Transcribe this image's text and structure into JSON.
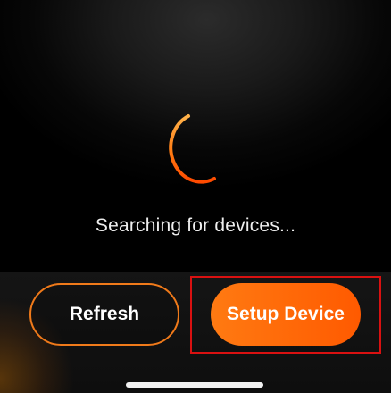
{
  "status": {
    "message": "Searching for devices..."
  },
  "actions": {
    "refresh_label": "Refresh",
    "setup_label": "Setup Device"
  },
  "icons": {
    "spinner": "loading-spinner-icon",
    "home": "home-indicator"
  },
  "colors": {
    "accent": "#ff6a00",
    "accent_light": "#ff8a2a",
    "highlight": "#d91111",
    "background": "#000000",
    "text": "#eeeeee"
  }
}
